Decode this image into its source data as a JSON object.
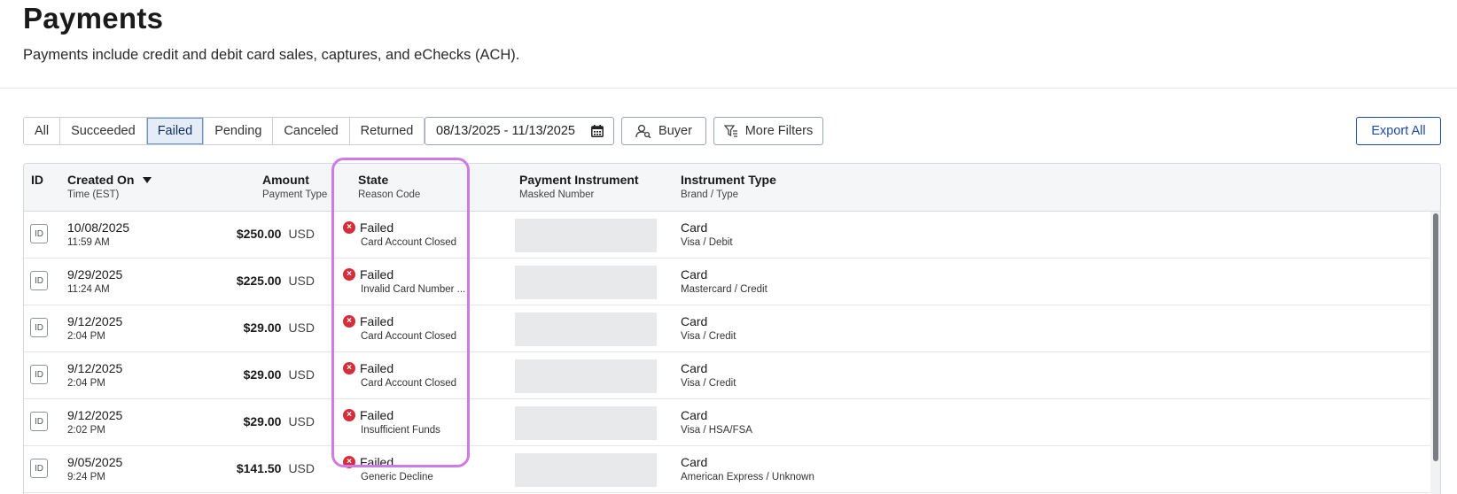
{
  "header": {
    "title": "Payments",
    "subtitle": "Payments include credit and debit card sales, captures, and eChecks (ACH)."
  },
  "filters": {
    "tabs": [
      {
        "label": "All",
        "active": false
      },
      {
        "label": "Succeeded",
        "active": false
      },
      {
        "label": "Failed",
        "active": true
      },
      {
        "label": "Pending",
        "active": false
      },
      {
        "label": "Canceled",
        "active": false
      },
      {
        "label": "Returned",
        "active": false
      }
    ],
    "date_range": "08/13/2025 - 11/13/2025",
    "date_icon": "calendar-icon",
    "buyer_label": "Buyer",
    "buyer_icon": "person-search-icon",
    "more_filters_label": "More Filters",
    "more_filters_icon": "filter-icon",
    "export_label": "Export All"
  },
  "table": {
    "columns": {
      "id": {
        "label": "ID"
      },
      "created": {
        "label": "Created On",
        "sub": "Time (EST)",
        "sorted": "desc"
      },
      "amount": {
        "label": "Amount",
        "sub": "Payment Type"
      },
      "state": {
        "label": "State",
        "sub": "Reason Code"
      },
      "instrument": {
        "label": "Payment Instrument",
        "sub": "Masked Number"
      },
      "type": {
        "label": "Instrument Type",
        "sub": "Brand / Type"
      }
    },
    "rows": [
      {
        "id_label": "ID",
        "date": "10/08/2025",
        "time": "11:59 AM",
        "amount": "$250.00",
        "currency": "USD",
        "state": "Failed",
        "reason": "Card Account Closed",
        "instrument_type": "Card",
        "brand": "Visa / Debit"
      },
      {
        "id_label": "ID",
        "date": "9/29/2025",
        "time": "11:24 AM",
        "amount": "$225.00",
        "currency": "USD",
        "state": "Failed",
        "reason": "Invalid Card Number ...",
        "instrument_type": "Card",
        "brand": "Mastercard / Credit"
      },
      {
        "id_label": "ID",
        "date": "9/12/2025",
        "time": "2:04 PM",
        "amount": "$29.00",
        "currency": "USD",
        "state": "Failed",
        "reason": "Card Account Closed",
        "instrument_type": "Card",
        "brand": "Visa / Credit"
      },
      {
        "id_label": "ID",
        "date": "9/12/2025",
        "time": "2:04 PM",
        "amount": "$29.00",
        "currency": "USD",
        "state": "Failed",
        "reason": "Card Account Closed",
        "instrument_type": "Card",
        "brand": "Visa / Credit"
      },
      {
        "id_label": "ID",
        "date": "9/12/2025",
        "time": "2:02 PM",
        "amount": "$29.00",
        "currency": "USD",
        "state": "Failed",
        "reason": "Insufficient Funds",
        "instrument_type": "Card",
        "brand": "Visa / HSA/FSA"
      },
      {
        "id_label": "ID",
        "date": "9/05/2025",
        "time": "9:24 PM",
        "amount": "$141.50",
        "currency": "USD",
        "state": "Failed",
        "reason": "Generic Decline",
        "instrument_type": "Card",
        "brand": "American Express / Unknown"
      }
    ]
  },
  "colors": {
    "failed": "#d42e3b",
    "highlight": "#cf7ae6",
    "accent": "#1c4aa5"
  }
}
